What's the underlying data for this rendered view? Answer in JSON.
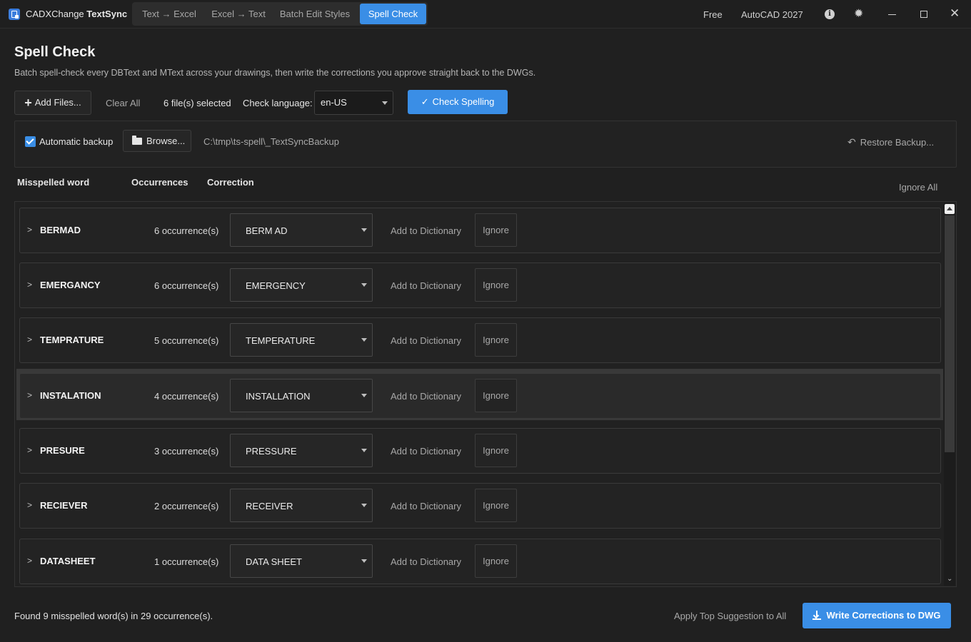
{
  "app": {
    "logo_icon": "document-icon",
    "title_regular": "CADXChange",
    "title_bold": "TextSync",
    "tabs": [
      {
        "label": "Text → Excel",
        "active": false
      },
      {
        "label": "Excel → Text",
        "active": false
      },
      {
        "label": "Batch Edit Styles",
        "active": false
      },
      {
        "label": "Spell Check",
        "active": true
      }
    ],
    "plan": "Free",
    "autocad_version": "AutoCAD 2027",
    "accent_color": "#3a8ee6"
  },
  "header": {
    "title": "Spell Check",
    "subtitle": "Batch spell-check every DBText and MText across your drawings, then write the corrections you approve straight back to the DWGs."
  },
  "toolbar": {
    "add_files_label": "Add Files...",
    "clear_all_label": "Clear All",
    "files_selected": "6 file(s) selected",
    "language_label": "Check language:",
    "language_value": "en-US",
    "check_spelling_label": "Check Spelling"
  },
  "backup": {
    "automatic_backup_label": "Automatic backup",
    "automatic_backup_checked": true,
    "browse_label": "Browse...",
    "path": "C:\\tmp\\ts-spell\\_TextSyncBackup",
    "restore_label": "Restore Backup..."
  },
  "columns": {
    "misspelled": "Misspelled word",
    "occurrences": "Occurrences",
    "correction": "Correction",
    "ignore_all": "Ignore All"
  },
  "rows": [
    {
      "word": "BERMAD",
      "occurrences": "6 occurrence(s)",
      "correction": "BERM AD",
      "add_label": "Add to Dictionary",
      "ignore_label": "Ignore"
    },
    {
      "word": "EMERGANCY",
      "occurrences": "6 occurrence(s)",
      "correction": "EMERGENCY",
      "add_label": "Add to Dictionary",
      "ignore_label": "Ignore"
    },
    {
      "word": "TEMPRATURE",
      "occurrences": "5 occurrence(s)",
      "correction": "TEMPERATURE",
      "add_label": "Add to Dictionary",
      "ignore_label": "Ignore"
    },
    {
      "word": "INSTALATION",
      "occurrences": "4 occurrence(s)",
      "correction": "INSTALLATION",
      "add_label": "Add to Dictionary",
      "ignore_label": "Ignore"
    },
    {
      "word": "PRESURE",
      "occurrences": "3 occurrence(s)",
      "correction": "PRESSURE",
      "add_label": "Add to Dictionary",
      "ignore_label": "Ignore"
    },
    {
      "word": "RECIEVER",
      "occurrences": "2 occurrence(s)",
      "correction": "RECEIVER",
      "add_label": "Add to Dictionary",
      "ignore_label": "Ignore"
    },
    {
      "word": "DATASHEET",
      "occurrences": "1 occurrence(s)",
      "correction": "DATA SHEET",
      "add_label": "Add to Dictionary",
      "ignore_label": "Ignore"
    }
  ],
  "footer": {
    "status": "Found 9 misspelled word(s) in 29 occurrence(s).",
    "apply_top_label": "Apply Top Suggestion to All",
    "write_label": "Write Corrections to DWG"
  }
}
